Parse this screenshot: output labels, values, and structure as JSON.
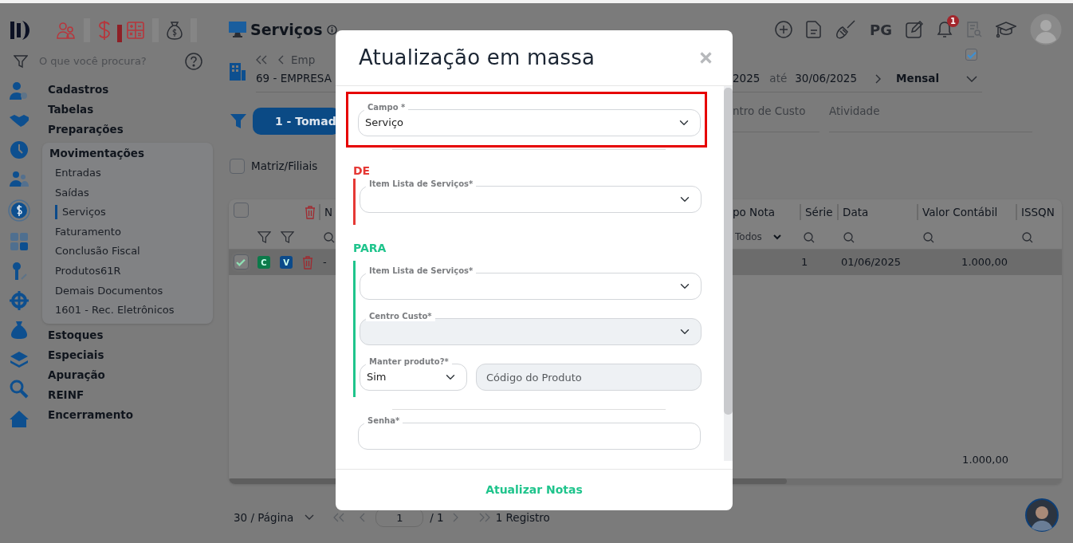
{
  "sidebar": {
    "search": {
      "placeholder": "O que você procura?"
    },
    "menu": [
      {
        "label": "Cadastros",
        "expanded": false
      },
      {
        "label": "Tabelas",
        "expanded": false
      },
      {
        "label": "Preparações",
        "expanded": false
      },
      {
        "label": "Movimentações",
        "expanded": true,
        "children": [
          {
            "label": "Entradas",
            "selected": false
          },
          {
            "label": "Saídas",
            "selected": false
          },
          {
            "label": "Serviços",
            "selected": true
          },
          {
            "label": "Faturamento",
            "selected": false
          },
          {
            "label": "Conclusão Fiscal",
            "selected": false
          },
          {
            "label": "Produtos61R",
            "selected": false
          },
          {
            "label": "Demais Documentos",
            "selected": false
          },
          {
            "label": "1601 - Rec. Eletrônicos",
            "selected": false
          }
        ]
      },
      {
        "label": "Estoques",
        "expanded": false
      },
      {
        "label": "Especiais",
        "expanded": false
      },
      {
        "label": "Apuração",
        "expanded": false
      },
      {
        "label": "REINF",
        "expanded": false
      },
      {
        "label": "Encerramento",
        "expanded": false
      }
    ]
  },
  "header": {
    "title": "Serviços",
    "toolbar_text": "PG",
    "notifications": "1"
  },
  "company": {
    "nav": "Emp",
    "name": "69 - EMPRESA"
  },
  "period": {
    "start": "2025",
    "separator": "até",
    "end": "30/06/2025",
    "frequency": "Mensal",
    "checked": true
  },
  "tabs": [
    {
      "label": "1 - Tomad",
      "selected": true
    }
  ],
  "filters": [
    {
      "label": "ntro de Custo"
    },
    {
      "label": "Atividade"
    }
  ],
  "matriz_filiais": {
    "label": "Matriz/Filiais",
    "checked": false
  },
  "table": {
    "select_all": {
      "checked": false
    },
    "columns": [
      "N",
      "po Nota",
      "Série",
      "Data",
      "Valor Contábil",
      "ISSQN"
    ],
    "type_filter": "Todos",
    "rows": [
      {
        "selected": true,
        "checked": true,
        "badges": [
          "C",
          "V"
        ],
        "number": "-",
        "serie": "1",
        "data": "01/06/2025",
        "valor": "1.000,00"
      }
    ],
    "total": "1.000,00"
  },
  "pagination": {
    "page_size": "30 / Página",
    "page": "1",
    "of": "/ 1",
    "records": "1 Registro"
  },
  "modal": {
    "title": "Atualização em massa",
    "campo": {
      "label": "Campo *",
      "value": "Serviço",
      "highlighted": true
    },
    "sections": [
      {
        "heading": "DE",
        "color": "#e53935",
        "fields": [
          {
            "kind": "select",
            "label": "Item Lista de Serviços*",
            "disabled": false
          }
        ]
      },
      {
        "heading": "PARA",
        "color": "#1fc48c",
        "fields": [
          {
            "kind": "select",
            "label": "Item Lista de Serviços*",
            "disabled": false
          },
          {
            "kind": "select",
            "label": "Centro Custo*",
            "disabled": true
          },
          {
            "kind": "pair",
            "label": "Manter produto?*",
            "value": "Sim",
            "placeholder": "Código do Produto",
            "disabled": true
          }
        ]
      }
    ],
    "password": {
      "label": "Senha*"
    },
    "submit": "Atualizar Notas"
  }
}
